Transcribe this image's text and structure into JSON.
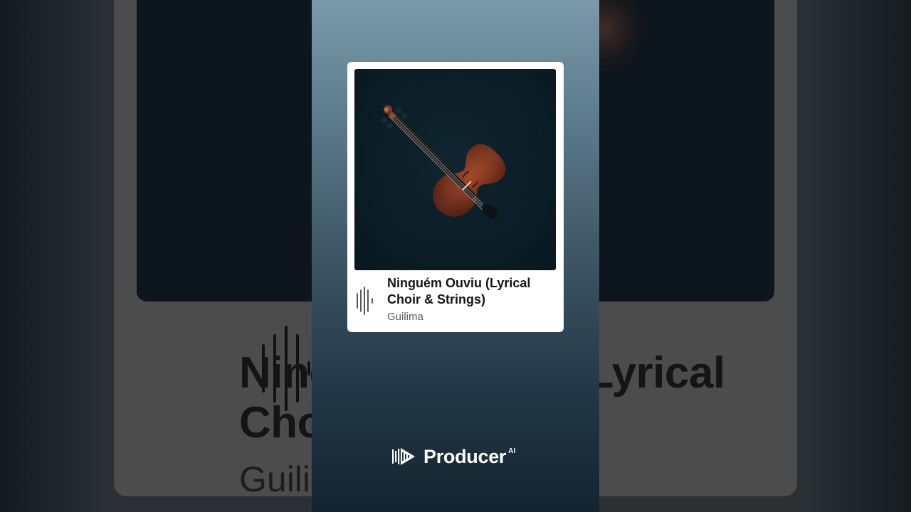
{
  "song": {
    "title": "Ninguém Ouviu (Lyrical\nChoir & Strings)",
    "artist": "Guilima",
    "artwork_icon": "violin-icon"
  },
  "brand": {
    "name": "Producer",
    "superscript": "AI",
    "logo_icon": "producer-logo-icon"
  },
  "colors": {
    "panel_top": "#7a9aaa",
    "panel_bottom": "#142330",
    "card": "#ffffff",
    "artwork_bg": "#0b1d26",
    "violin_body": "#7a3520"
  }
}
